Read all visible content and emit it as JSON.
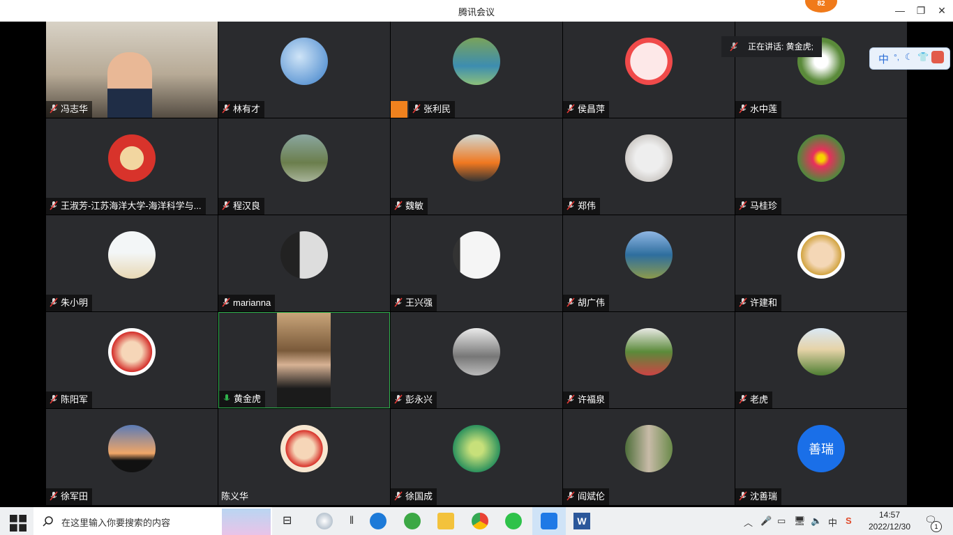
{
  "window": {
    "title": "腾讯会议",
    "badge": "82"
  },
  "speaking": {
    "label": "正在讲话: 黄金虎;"
  },
  "ime": {
    "char": "中"
  },
  "participants": [
    {
      "name": "冯志华",
      "mic": "muted",
      "avatar": "video-desk"
    },
    {
      "name": "林有才",
      "mic": "muted",
      "avatar": "sky"
    },
    {
      "name": "张利民",
      "mic": "muted",
      "avatar": "lake",
      "badge": "user-badge"
    },
    {
      "name": "侯昌萍",
      "mic": "muted",
      "avatar": "pig"
    },
    {
      "name": "水中莲",
      "mic": "muted",
      "avatar": "flowers-white"
    },
    {
      "name": "王淑芳-江苏海洋大学-海洋科学与...",
      "mic": "muted",
      "avatar": "fu"
    },
    {
      "name": "程汉良",
      "mic": "muted",
      "avatar": "outdoor-people"
    },
    {
      "name": "魏敏",
      "mic": "muted",
      "avatar": "lifejacket"
    },
    {
      "name": "郑伟",
      "mic": "muted",
      "avatar": "tree-diagram"
    },
    {
      "name": "马桂珍",
      "mic": "muted",
      "avatar": "red-flower"
    },
    {
      "name": "朱小明",
      "mic": "muted",
      "avatar": "beach"
    },
    {
      "name": "marianna",
      "mic": "muted",
      "avatar": "woman"
    },
    {
      "name": "王兴强",
      "mic": "muted",
      "avatar": "calligraphy"
    },
    {
      "name": "胡广伟",
      "mic": "muted",
      "avatar": "building"
    },
    {
      "name": "许建和",
      "mic": "muted",
      "avatar": "cartoon-official"
    },
    {
      "name": "陈阳军",
      "mic": "muted",
      "avatar": "cartoon-boy"
    },
    {
      "name": "黄金虎",
      "mic": "active",
      "avatar": "video-man"
    },
    {
      "name": "彭永兴",
      "mic": "muted",
      "avatar": "snow"
    },
    {
      "name": "许福泉",
      "mic": "muted",
      "avatar": "path"
    },
    {
      "name": "老虎",
      "mic": "muted",
      "avatar": "house"
    },
    {
      "name": "徐军田",
      "mic": "muted",
      "avatar": "sunset"
    },
    {
      "name": "陈义华",
      "mic": "none",
      "avatar": "cartoon-newyear"
    },
    {
      "name": "徐国成",
      "mic": "muted",
      "avatar": "fish"
    },
    {
      "name": "阎斌伦",
      "mic": "muted",
      "avatar": "rock"
    },
    {
      "name": "沈善瑞",
      "mic": "muted",
      "avatar": "text",
      "avatar_text": "善瑞"
    }
  ],
  "taskbar": {
    "search_placeholder": "在这里输入你要搜索的内容",
    "time": "14:57",
    "date": "2022/12/30",
    "ime_indicator": "中",
    "notifications": "1"
  },
  "colors": {
    "tile_bg": "#2a2b2e",
    "active_border": "#2fb24c",
    "muted_red": "#e53935",
    "accent_blue": "#1a6fe8"
  }
}
